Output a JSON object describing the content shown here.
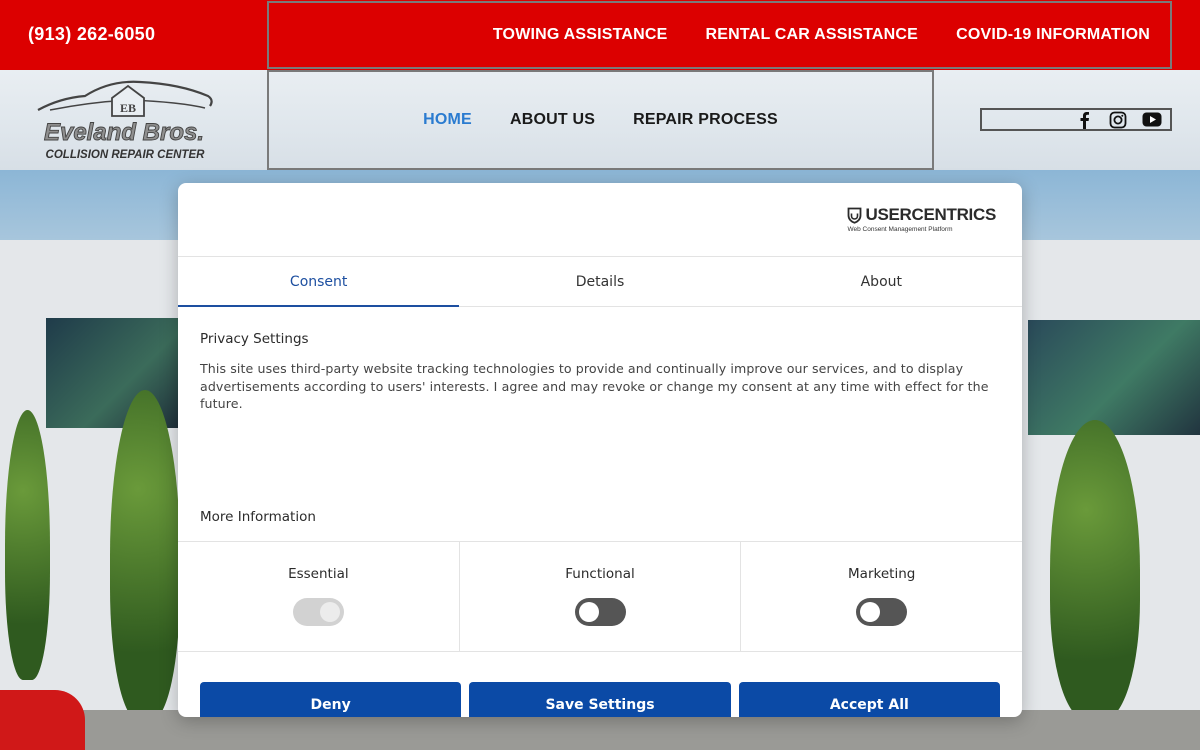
{
  "topbar": {
    "phone": "(913) 262-6050",
    "links": [
      "TOWING ASSISTANCE",
      "RENTAL CAR ASSISTANCE",
      "COVID-19 INFORMATION"
    ]
  },
  "header": {
    "logo_top": "EB",
    "logo_name": "Eveland Bros.",
    "logo_tagline": "COLLISION REPAIR CENTER",
    "nav": [
      {
        "label": "HOME",
        "active": true
      },
      {
        "label": "ABOUT US",
        "active": false
      },
      {
        "label": "REPAIR PROCESS",
        "active": false
      }
    ],
    "social_icons": [
      "facebook-icon",
      "instagram-icon",
      "youtube-icon"
    ],
    "active_color": "#2a7bd0"
  },
  "consent": {
    "brand": "USERCENTRICS",
    "brand_sub": "Web Consent Management Platform",
    "tabs": [
      {
        "label": "Consent",
        "active": true
      },
      {
        "label": "Details",
        "active": false
      },
      {
        "label": "About",
        "active": false
      }
    ],
    "title": "Privacy Settings",
    "text": "This site uses third-party website tracking technologies to provide and continually improve our services, and to display advertisements according to users' interests. I agree and may revoke or change my consent at any time with effect for the future.",
    "more_info": "More Information",
    "categories": [
      {
        "label": "Essential",
        "enabled": true,
        "disabled": true
      },
      {
        "label": "Functional",
        "enabled": false,
        "disabled": false
      },
      {
        "label": "Marketing",
        "enabled": false,
        "disabled": false
      }
    ],
    "buttons": {
      "deny": "Deny",
      "save": "Save Settings",
      "accept": "Accept All"
    },
    "accent": "#0b4aa6"
  }
}
